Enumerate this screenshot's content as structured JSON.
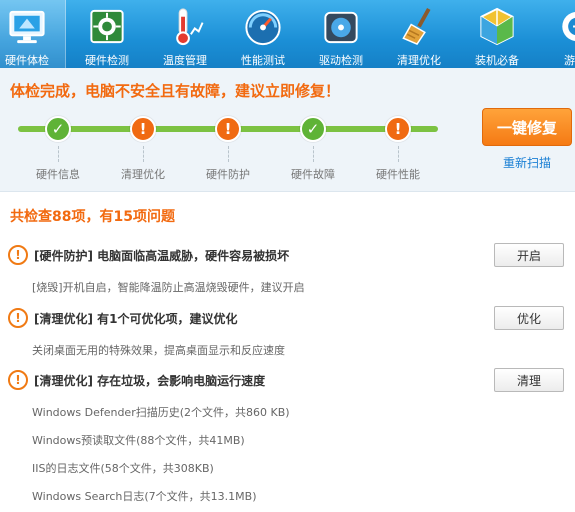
{
  "toolbar": {
    "items": [
      {
        "label": "硬件体检",
        "icon": "monitor-icon",
        "active": true
      },
      {
        "label": "硬件检测",
        "icon": "circuit-board-icon",
        "active": false
      },
      {
        "label": "温度管理",
        "icon": "thermometer-icon",
        "active": false
      },
      {
        "label": "性能测试",
        "icon": "speedometer-icon",
        "active": false
      },
      {
        "label": "驱动检测",
        "icon": "driver-disc-icon",
        "active": false
      },
      {
        "label": "清理优化",
        "icon": "broom-icon",
        "active": false
      },
      {
        "label": "装机必备",
        "icon": "cube-icon",
        "active": false
      },
      {
        "label": "游戏",
        "icon": "gamepad-icon",
        "active": false
      }
    ]
  },
  "status": {
    "title": "体检完成，电脑不安全且有故障，建议立即修复！",
    "steps": [
      {
        "label": "硬件信息",
        "state": "ok"
      },
      {
        "label": "清理优化",
        "state": "warn"
      },
      {
        "label": "硬件防护",
        "state": "warn"
      },
      {
        "label": "硬件故障",
        "state": "ok"
      },
      {
        "label": "硬件性能",
        "state": "warn"
      }
    ],
    "fix_button": "一键修复",
    "rescan_link": "重新扫描"
  },
  "results": {
    "summary": "共检查88项，有15项问题",
    "issues": [
      {
        "text": "[硬件防护] 电脑面临高温威胁，硬件容易被损坏",
        "button": "开启"
      },
      {
        "text": "[清理优化] 有1个可优化项，建议优化",
        "button": "优化"
      },
      {
        "text": "[清理优化] 存在垃圾，会影响电脑运行速度",
        "button": "清理"
      }
    ],
    "details": [
      "[烧毁]开机自启，智能降温防止高温烧毁硬件，建议开启",
      "关闭桌面无用的特殊效果，提高桌面显示和反应速度",
      "Windows Defender扫描历史(2个文件，共860 KB)",
      "Windows预读取文件(88个文件，共41MB)",
      "IIS的日志文件(58个文件，共308KB)",
      "Windows Search日志(7个文件，共13.1MB)"
    ]
  },
  "colors": {
    "accent_orange": "#f26a10",
    "ok_green": "#5fb336",
    "toolbar_blue": "#1b8fd6",
    "link_blue": "#1a7fd4"
  }
}
